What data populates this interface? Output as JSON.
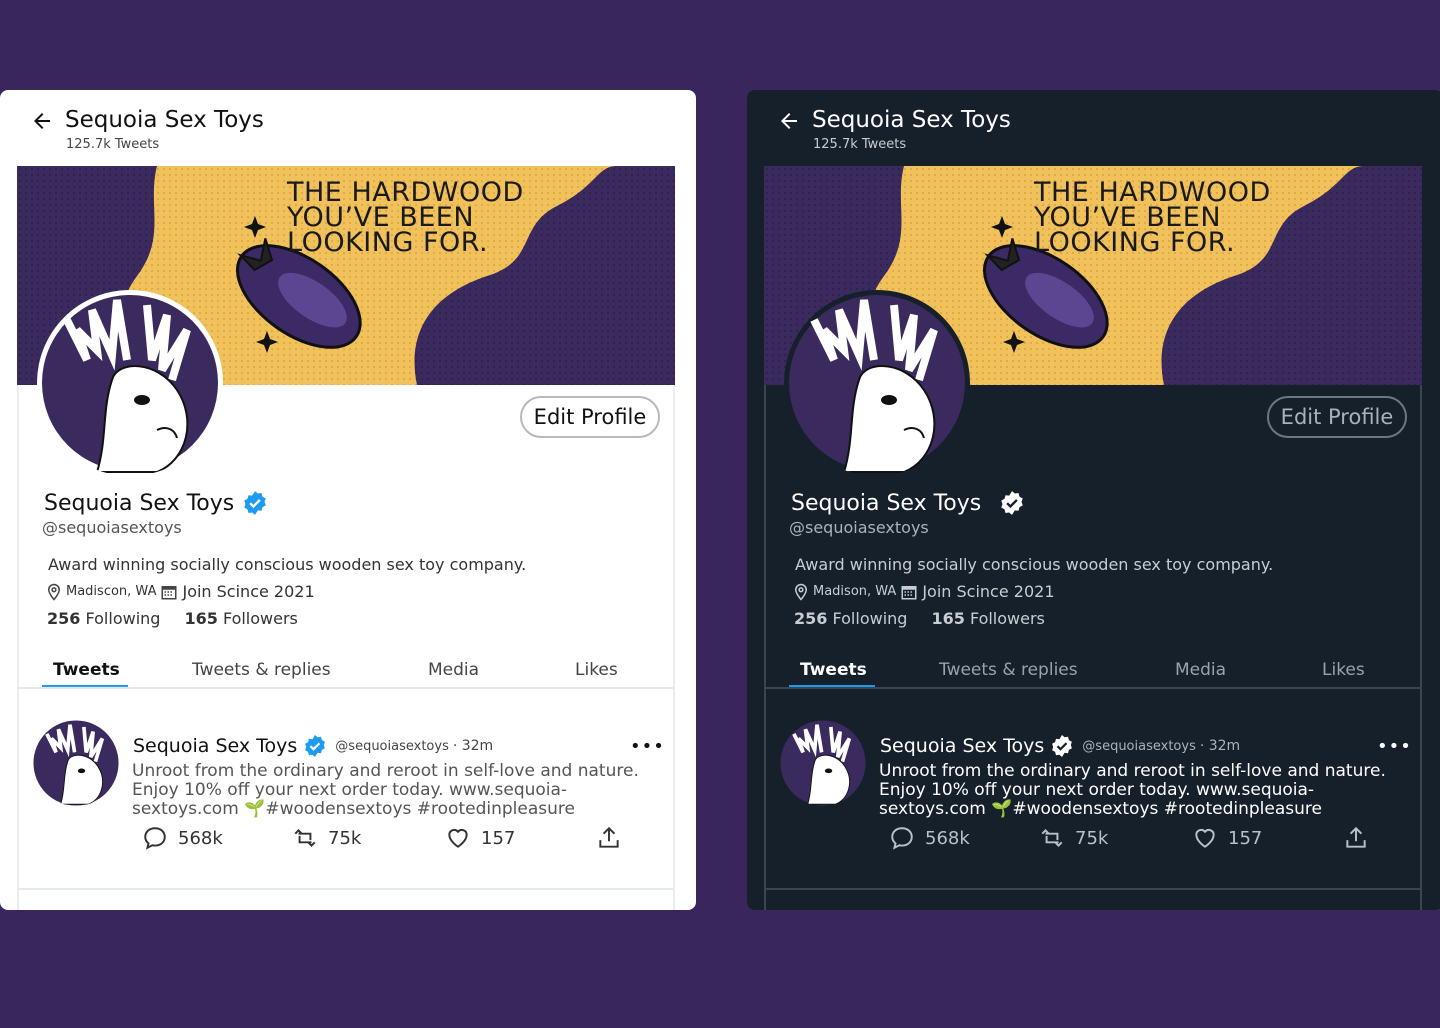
{
  "panels": [
    {
      "theme": "light",
      "header": {
        "title": "Sequoia Sex Toys",
        "tweets_count": "125.7k Tweets"
      },
      "banner": {
        "tagline": "THE HARDWOOD\nYOU’VE BEEN\nLOOKING FOR."
      },
      "edit_profile_label": "Edit Profile",
      "profile": {
        "name": "Sequoia Sex Toys",
        "handle": "@sequoiasextoys",
        "bio": "Award winning socially conscious wooden sex toy company.",
        "location": "Madiscon, WA",
        "joined": "Join Scince 2021",
        "following_count": "256",
        "following_label": "Following",
        "followers_count": "165",
        "followers_label": "Followers"
      },
      "tabs": [
        "Tweets",
        "Tweets & replies",
        "Media",
        "Likes"
      ],
      "tweet": {
        "name": "Sequoia Sex Toys",
        "handle": "@sequoiasextoys",
        "time": "· 32m",
        "more": "•••",
        "body": "Unroot from the ordinary and reroot in self-love and nature. Enjoy 10% off your next order today. www.sequoia-sextoys.com 🌱#woodensextoys #rootedinpleasure",
        "replies": "568k",
        "retweets": "75k",
        "likes": "157"
      }
    },
    {
      "theme": "dark",
      "header": {
        "title": "Sequoia Sex Toys",
        "tweets_count": "125.7k Tweets"
      },
      "banner": {
        "tagline": "THE HARDWOOD\nYOU’VE BEEN\nLOOKING FOR."
      },
      "edit_profile_label": "Edit Profile",
      "profile": {
        "name": "Sequoia Sex Toys",
        "handle": "@sequoiasextoys",
        "bio": "Award winning socially conscious wooden sex toy company.",
        "location": "Madison, WA",
        "joined": "Join Scince 2021",
        "following_count": "256",
        "following_label": "Following",
        "followers_count": "165",
        "followers_label": "Followers"
      },
      "tabs": [
        "Tweets",
        "Tweets & replies",
        "Media",
        "Likes"
      ],
      "tweet": {
        "name": "Sequoia Sex Toys",
        "handle": "@sequoiasextoys",
        "time": "· 32m",
        "more": "•••",
        "body": "Unroot from the ordinary and reroot in self-love and nature. Enjoy 10% off your next order today. www.sequoia-sextoys.com 🌱#woodensextoys #rootedinpleasure",
        "replies": "568k",
        "retweets": "75k",
        "likes": "157"
      }
    }
  ],
  "colors": {
    "background": "#39265c",
    "banner_yellow": "#f1c25b",
    "banner_purple": "#3b2a5e",
    "accent_blue": "#1d9bf0",
    "dark_panel": "#15202b"
  }
}
